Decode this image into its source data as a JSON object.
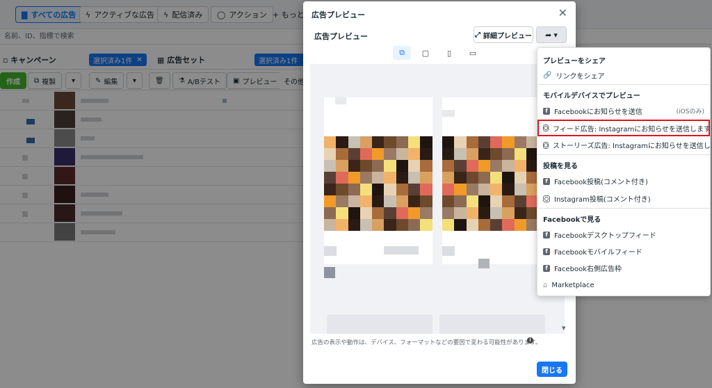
{
  "filters": {
    "all_ads": "すべての広告",
    "active_ads": "アクティブな広告",
    "delivered": "配信済み",
    "actions": "アクション",
    "more": "+ もっと見"
  },
  "search_placeholder": "名前、ID、指標で検索",
  "tabs": {
    "campaign": "キャンペーン",
    "campaign_selected": "選択済み1件",
    "adset": "広告セット",
    "adset_selected": "選択済み1件"
  },
  "toolbar": {
    "create": "作成",
    "duplicate": "複製",
    "edit": "編集",
    "ab_test": "A/Bテスト",
    "preview": "プレビュー",
    "other": "その他"
  },
  "modal": {
    "title": "広告プレビュー",
    "subtitle": "広告プレビュー",
    "detail_preview": "詳細プレビュー",
    "disclaimer": "広告の表示や動作は、デバイス、フォーマットなどの要因で変わる可能性があります。",
    "close_button": "閉じる"
  },
  "menu": {
    "share_section": "プレビューをシェア",
    "share_link": "リンクをシェア",
    "mobile_section": "モバイルデバイスでプレビュー",
    "fb_notify": "Facebookにお知らせを送信",
    "fb_notify_note": "(iOSのみ)",
    "ig_feed": "フィード広告: Instagramにお知らせを送信します",
    "ig_stories": "ストーリーズ広告: Instagramにお知らせを送信します",
    "posts_section": "投稿を見る",
    "fb_post": "Facebook投稿(コメント付き)",
    "ig_post": "Instagram投稿(コメント付き)",
    "fb_section": "Facebookで見る",
    "fb_desktop": "Facebookデスクトップフィード",
    "fb_mobile": "Facebookモバイルフィード",
    "fb_right": "Facebook右側広告枠",
    "marketplace": "Marketplace"
  },
  "colors": {
    "accent": "#1877f2",
    "create_green": "#42b72a",
    "highlight": "#e0141e"
  }
}
